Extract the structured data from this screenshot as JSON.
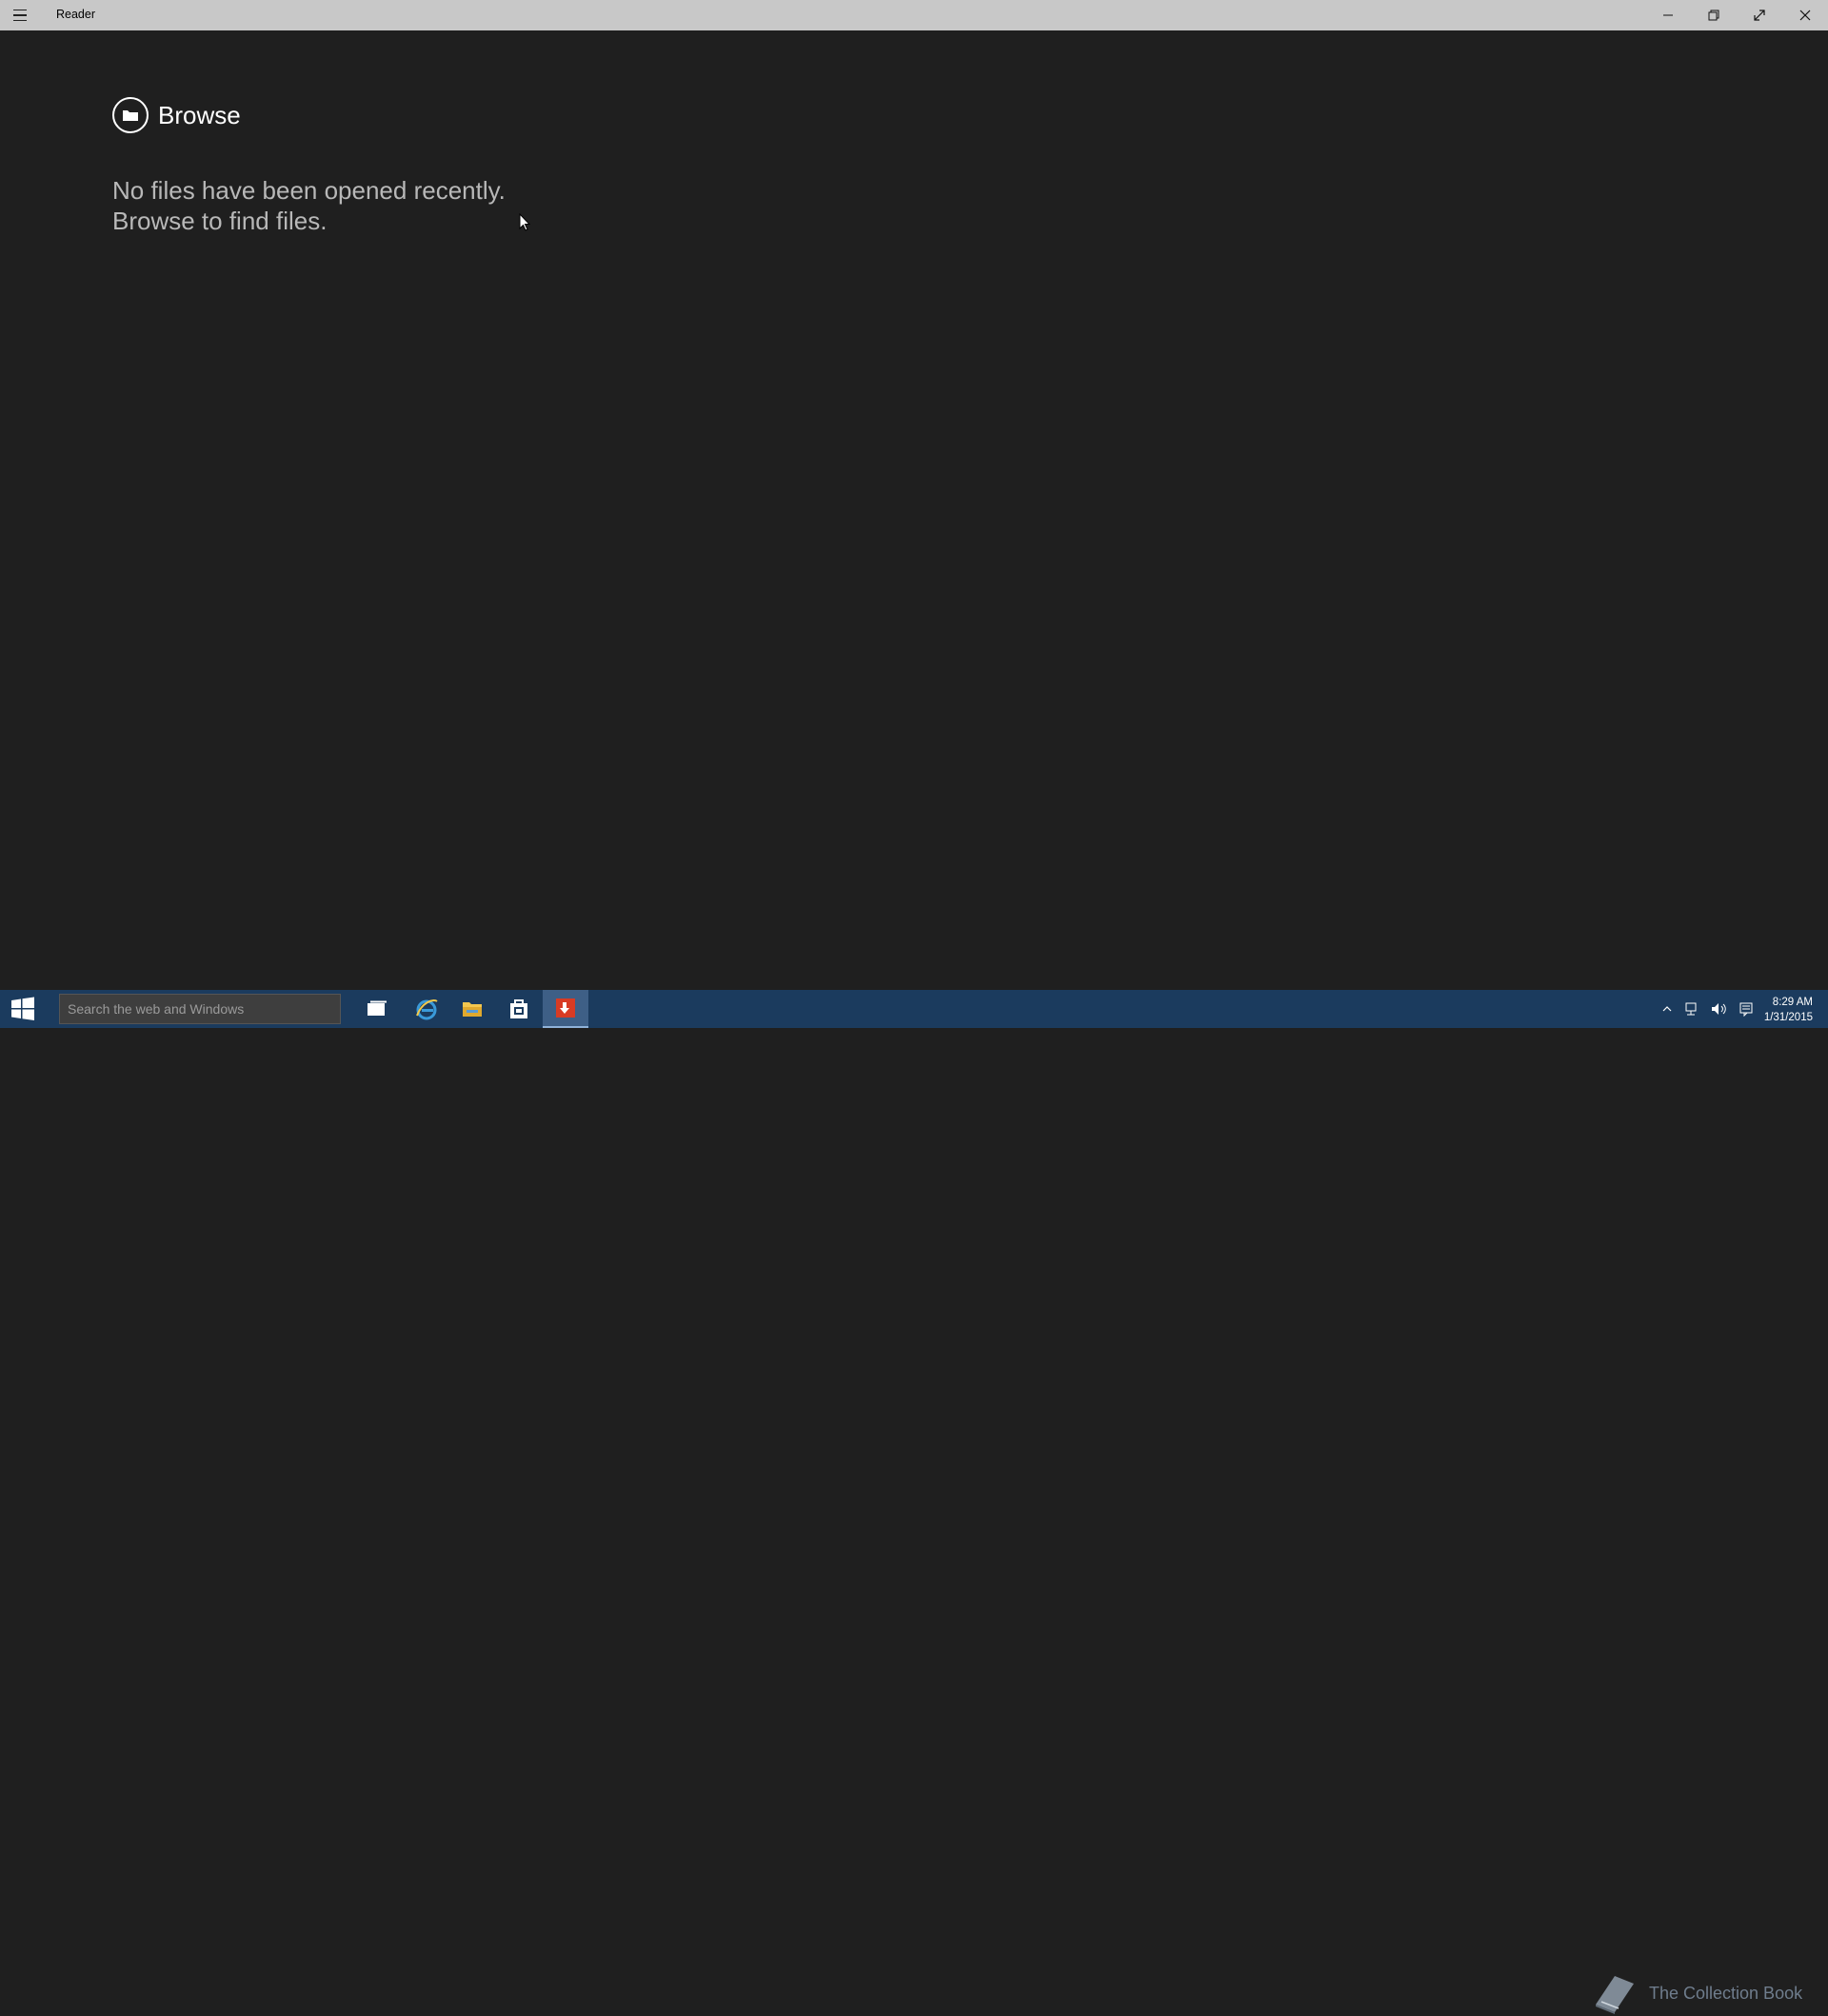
{
  "window": {
    "title": "Reader"
  },
  "main": {
    "browse_label": "Browse",
    "empty_line1": "No files have been opened recently.",
    "empty_line2": "Browse to find files."
  },
  "taskbar": {
    "search_placeholder": "Search the web and Windows",
    "watermark_text": "The Collection Book",
    "time": "8:29 AM",
    "date": "1/31/2015"
  },
  "colors": {
    "titlebar": "#c8c8c8",
    "background": "#1f1f1f",
    "taskbar": "#1b3b5e",
    "accent_red": "#d83b24"
  }
}
